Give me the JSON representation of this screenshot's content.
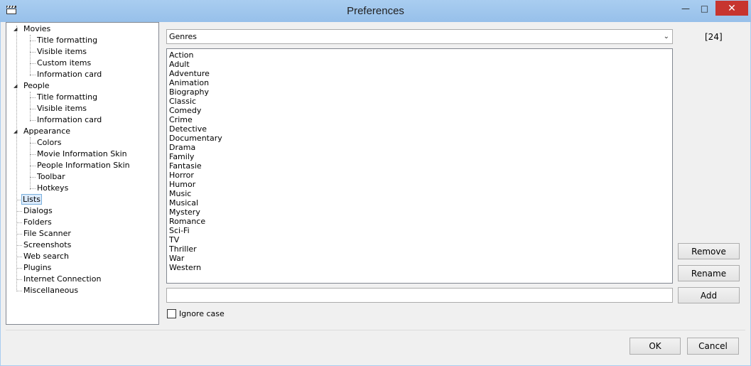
{
  "window": {
    "title": "Preferences",
    "minimize_label": "—",
    "maximize_label": "□",
    "close_label": "✕"
  },
  "tree": {
    "movies": {
      "label": "Movies",
      "children": [
        "Title formatting",
        "Visible items",
        "Custom items",
        "Information card"
      ]
    },
    "people": {
      "label": "People",
      "children": [
        "Title formatting",
        "Visible items",
        "Information card"
      ]
    },
    "appearance": {
      "label": "Appearance",
      "children": [
        "Colors",
        "Movie Information Skin",
        "People Information Skin",
        "Toolbar",
        "Hotkeys"
      ]
    },
    "top_items": [
      "Lists",
      "Dialogs",
      "Folders",
      "File Scanner",
      "Screenshots",
      "Web search",
      "Plugins",
      "Internet Connection",
      "Miscellaneous"
    ],
    "selected": "Lists"
  },
  "list_selector": {
    "value": "Genres"
  },
  "count": "[24]",
  "genres": [
    "Action",
    "Adult",
    "Adventure",
    "Animation",
    "Biography",
    "Classic",
    "Comedy",
    "Crime",
    "Detective",
    "Documentary",
    "Drama",
    "Family",
    "Fantasie",
    "Horror",
    "Humor",
    "Music",
    "Musical",
    "Mystery",
    "Romance",
    "Sci-Fi",
    "TV",
    "Thriller",
    "War",
    "Western"
  ],
  "new_item_value": "",
  "ignore_case": {
    "label": "Ignore case",
    "checked": false
  },
  "buttons": {
    "remove": "Remove",
    "rename": "Rename",
    "add": "Add",
    "ok": "OK",
    "cancel": "Cancel"
  },
  "icons": {
    "app": "clapperboard-icon",
    "expanded": "triangle-expanded-icon",
    "dropdown": "chevron-down-icon"
  }
}
